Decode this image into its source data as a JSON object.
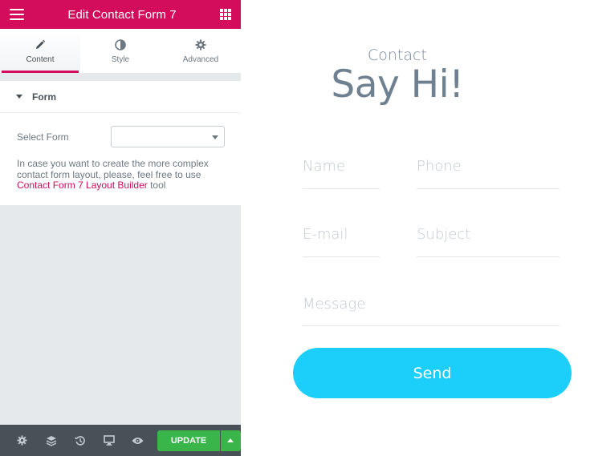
{
  "panel": {
    "title": "Edit Contact Form 7",
    "tabs": [
      {
        "label": "Content",
        "icon": "pencil-icon",
        "active": true
      },
      {
        "label": "Style",
        "icon": "half-circle-icon",
        "active": false
      },
      {
        "label": "Advanced",
        "icon": "gear-icon",
        "active": false
      }
    ],
    "section": {
      "title": "Form",
      "select_label": "Select Form",
      "select_value": "",
      "desc_before": "In case you want to create the more complex contact form layout, please, feel free to use ",
      "desc_link": "Contact Form 7 Layout Builder",
      "desc_after": " tool"
    },
    "footer": {
      "update_label": "UPDATE",
      "icons": [
        "settings-icon",
        "layers-icon",
        "history-icon",
        "responsive-icon",
        "preview-eye-icon"
      ]
    },
    "colors": {
      "brand": "#d30c5c",
      "update": "#39b54a",
      "footer_bg": "#495157"
    }
  },
  "preview": {
    "eyebrow": "Contact",
    "heading": "Say Hi!",
    "fields": {
      "name": "Name",
      "phone": "Phone",
      "email": "E-mail",
      "subject": "Subject",
      "message": "Message"
    },
    "send_label": "Send",
    "send_color": "#1ccefa"
  }
}
